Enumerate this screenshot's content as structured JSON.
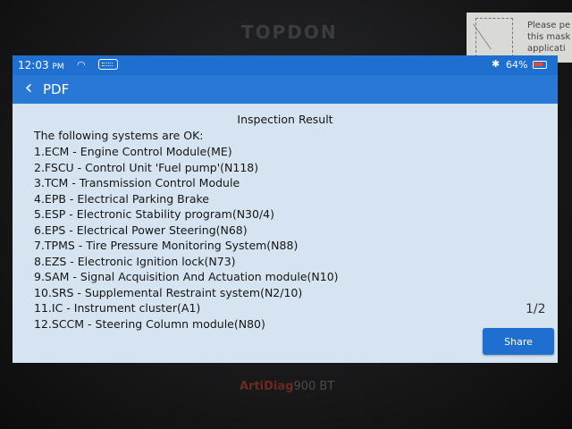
{
  "device": {
    "brand": "TOPDON",
    "model_prefix": "ArtiDiag",
    "model_suffix": "900 BT"
  },
  "sticker": {
    "text": "Please pe\nthis mask\napplicati"
  },
  "status_bar": {
    "time": "12:03",
    "ampm": "PM",
    "battery": "64%",
    "wifi_glyph": "◠",
    "bt_glyph": "✱"
  },
  "nav": {
    "title": "PDF",
    "back_glyph": "‹"
  },
  "document": {
    "heading": "Inspection Result",
    "intro": "The following systems are OK:",
    "items": [
      "1.ECM - Engine Control Module(ME)",
      "2.FSCU - Control Unit 'Fuel pump'(N118)",
      "3.TCM - Transmission Control Module",
      "4.EPB - Electrical Parking Brake",
      "5.ESP - Electronic Stability program(N30/4)",
      "6.EPS - Electrical Power Steering(N68)",
      "7.TPMS - Tire Pressure Monitoring System(N88)",
      "8.EZS - Electronic Ignition lock(N73)",
      "9.SAM - Signal Acquisition And Actuation module(N10)",
      "10.SRS - Supplemental Restraint system(N2/10)",
      "11.IC - Instrument cluster(A1)",
      "12.SCCM - Steering Column module(N80)"
    ],
    "page_indicator": "1/2",
    "share_label": "Share"
  }
}
